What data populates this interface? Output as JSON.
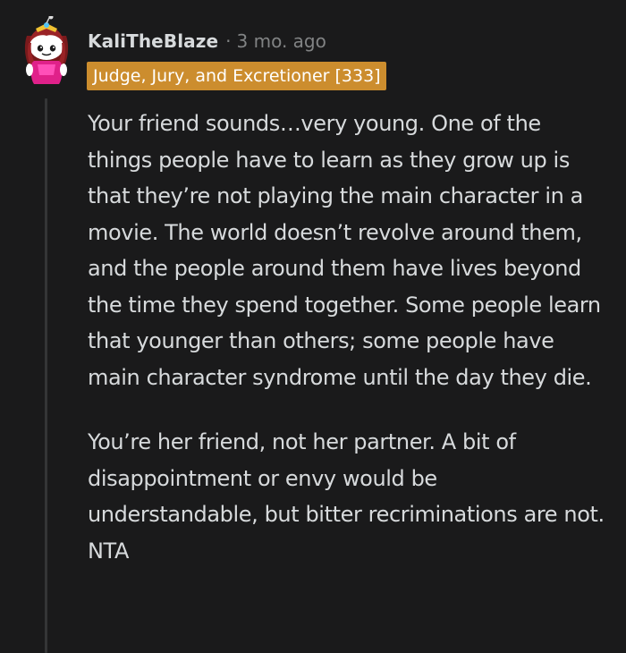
{
  "comment": {
    "author": "KaliTheBlaze",
    "separator": "·",
    "timestamp": "3 mo. ago",
    "flair": "Judge, Jury, and Excretioner [333]",
    "flair_color": "#cc8d2e",
    "paragraphs": [
      "Your friend sounds…very young. One of the things people have to learn as they grow up is that they’re not playing the main character in a movie. The world doesn’t revolve around them, and the people around them have lives beyond the time they spend together. Some people learn that younger than others; some people have main character syndrome until the day they die.",
      "You’re her friend, not her partner. A bit of disappointment or envy would be understandable, but bitter recriminations are not. NTA"
    ]
  },
  "colors": {
    "background": "#1a1a1b",
    "text": "#d7dadc",
    "meta": "#818384",
    "thread_line": "#343536"
  },
  "icons": {
    "avatar": "reddit-snoo-avatar-icon"
  }
}
